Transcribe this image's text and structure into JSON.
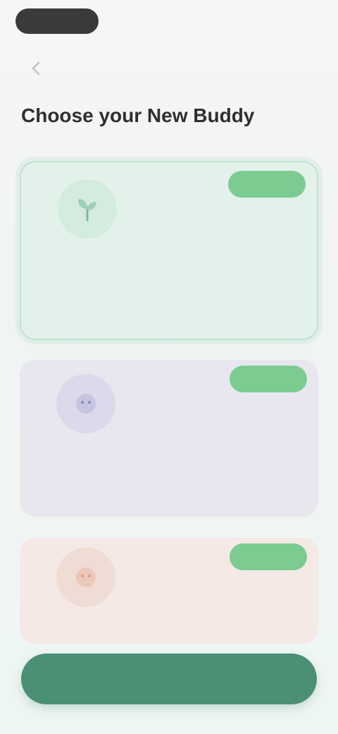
{
  "status_bar": {
    "time": "",
    "right_text": ""
  },
  "header": {
    "back_label": "",
    "title": "Choose your New Buddy"
  },
  "cards": [
    {
      "name": "",
      "subtitle": "",
      "badge": "",
      "description": "",
      "icon": "plant-icon",
      "color": "#e3f1eb",
      "selected": true
    },
    {
      "name": "",
      "subtitle": "",
      "badge": "",
      "description": "",
      "icon": "buddy-icon",
      "color": "#e8e7f0"
    },
    {
      "name": "",
      "subtitle": "",
      "badge": "",
      "description": "",
      "icon": "buddy-icon",
      "color": "#f4e9e4"
    }
  ],
  "footer": {
    "continue_label": ""
  },
  "colors": {
    "accent": "#4b8f74",
    "badge": "#7ccc92"
  }
}
